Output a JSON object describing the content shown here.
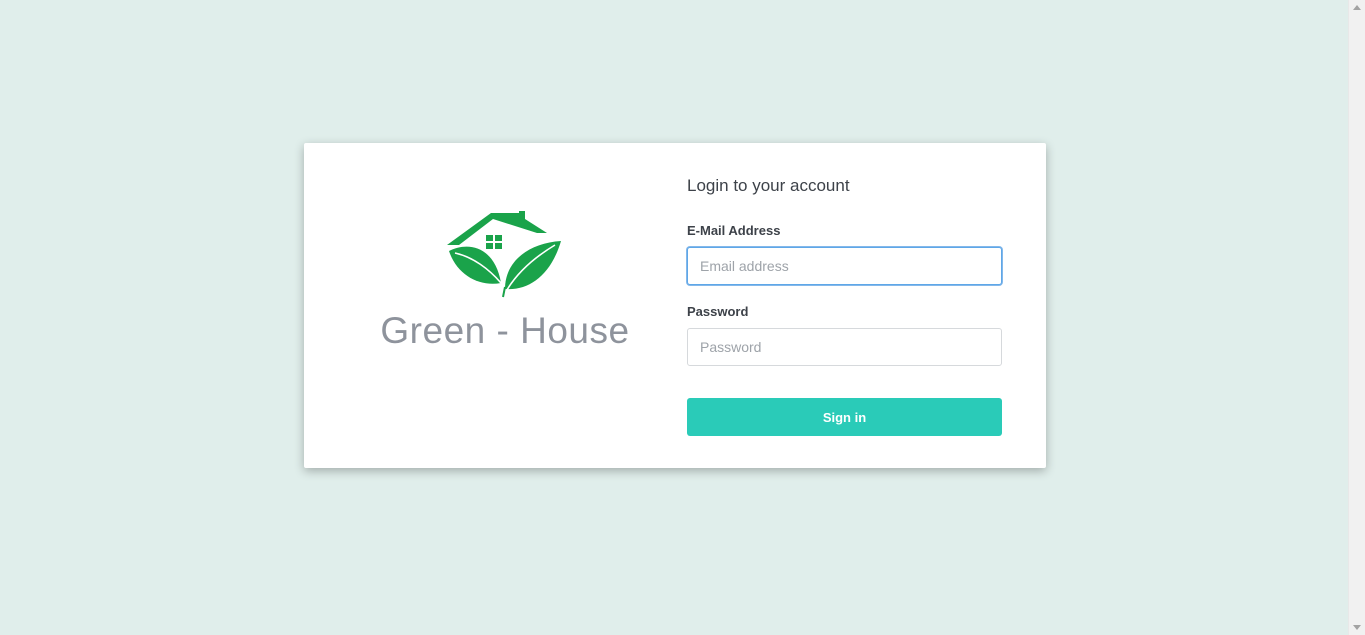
{
  "brand": {
    "name": "Green - House",
    "logo_icon": "house-leaf-icon",
    "logo_color": "#1aa34a"
  },
  "form": {
    "title": "Login to your account",
    "email": {
      "label": "E-Mail Address",
      "placeholder": "Email address",
      "value": ""
    },
    "password": {
      "label": "Password",
      "placeholder": "Password",
      "value": ""
    },
    "submit_label": "Sign in"
  },
  "colors": {
    "background": "#e0eeeb",
    "button": "#2acbb8",
    "focus_border": "#5ea7e8"
  }
}
